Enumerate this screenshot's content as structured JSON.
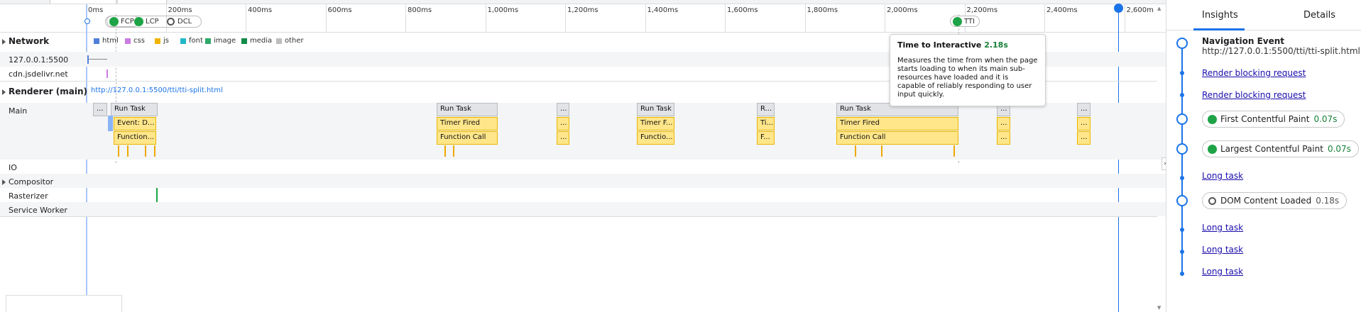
{
  "ruler": {
    "ticks": [
      "0ms",
      "200ms",
      "400ms",
      "600ms",
      "800ms",
      "1,000ms",
      "1,200ms",
      "1,400ms",
      "1,600ms",
      "1,800ms",
      "2,000ms",
      "2,200ms",
      "2,400ms",
      "2,600m"
    ],
    "markers": {
      "fcp": "FCP",
      "lcp": "LCP",
      "dcl": "DCL",
      "tti": "TTI"
    }
  },
  "network": {
    "label": "Network",
    "legend": [
      {
        "label": "html",
        "color": "#4f7fd9"
      },
      {
        "label": "css",
        "color": "#c97de0"
      },
      {
        "label": "js",
        "color": "#f0b400"
      },
      {
        "label": "font",
        "color": "#20b8c7"
      },
      {
        "label": "image",
        "color": "#2fa868"
      },
      {
        "label": "media",
        "color": "#0f8a4a"
      },
      {
        "label": "other",
        "color": "#bdbdbd"
      }
    ],
    "hosts": [
      "127.0.0.1:5500",
      "cdn.jsdelivr.net"
    ]
  },
  "renderer": {
    "label": "Renderer (main)",
    "url": "http://127.0.0.1:5500/tti/tti-split.html",
    "main_label": "Main",
    "tracks": [
      "IO",
      "Compositor",
      "Rasterizer",
      "Service Worker"
    ],
    "tasks": {
      "ellipsis": "...",
      "run_task": "Run Task",
      "run_task_short": "R...",
      "event_d": "Event: D...",
      "function_short": "Function...",
      "function_call": "Function Call",
      "functio_short": "Functio...",
      "timer_fired": "Timer Fired",
      "timer_f_short": "Timer F...",
      "ti_short": "Ti...",
      "f_short": "F..."
    }
  },
  "tooltip": {
    "title": "Time to Interactive",
    "value": "2.18s",
    "body": "Measures the time from when the page starts loading to when its main sub-resources have loaded and it is capable of reliably responding to user input quickly."
  },
  "sidebar": {
    "tabs": [
      "Insights",
      "Details"
    ],
    "active_tab": "Insights",
    "events": {
      "nav_title": "Navigation Event",
      "nav_url": "http://127.0.0.1:5500/tti/tti-split.html",
      "render_blocking_1": "Render blocking request",
      "render_blocking_2": "Render blocking request",
      "fcp_label": "First Contentful Paint",
      "fcp_time": "0.07s",
      "lcp_label": "Largest Contentful Paint",
      "lcp_time": "0.07s",
      "long_task_1": "Long task",
      "dcl_label": "DOM Content Loaded",
      "dcl_time": "0.18s",
      "long_task_2": "Long task",
      "long_task_3": "Long task",
      "long_task_4": "Long task"
    }
  },
  "colors": {
    "accent": "#1a73e8",
    "green": "#1ea446",
    "task_yellow": "#ffe68a",
    "task_gray": "#e1e3e6"
  }
}
